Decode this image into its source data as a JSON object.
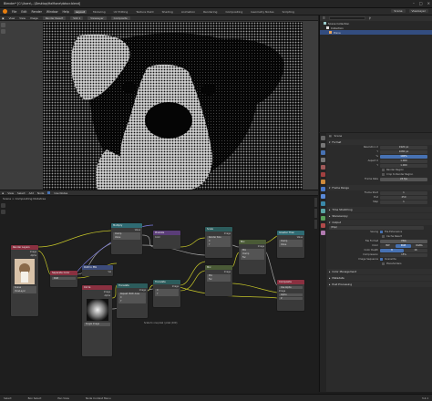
{
  "window": {
    "title": "Blender* [C:\\Users\\...\\Desktop\\Halftone\\dotscr.blend]"
  },
  "menu": {
    "items": [
      "File",
      "Edit",
      "Render",
      "Window",
      "Help"
    ],
    "workspaces": [
      "Layout",
      "Modeling",
      "UV Editing",
      "Texture Paint",
      "Shading",
      "Animation",
      "Rendering",
      "Compositing",
      "Geometry Nodes",
      "Scripting"
    ],
    "active_workspace": "Layout",
    "scene": "Scene",
    "view_layer": "ViewLayer"
  },
  "image_editor": {
    "header": [
      "View",
      "View",
      "Image",
      "Render Result"
    ],
    "slot": "Slot 1",
    "layer": "ViewLayer",
    "pass": "Composite"
  },
  "outliner": {
    "search_placeholder": "",
    "rows": [
      {
        "label": "Scene Collection",
        "selected": false
      },
      {
        "label": "Collection",
        "selected": false
      },
      {
        "label": "Plane",
        "selected": true
      }
    ]
  },
  "properties": {
    "scene_label": "Scene",
    "format_header": "Format",
    "rows": [
      {
        "label": "Resolution X",
        "value": "1920 px",
        "style": "dark"
      },
      {
        "label": "Y",
        "value": "1080 px",
        "style": "dark"
      },
      {
        "label": "%",
        "value": "100%",
        "style": "blue"
      },
      {
        "label": "Aspect X",
        "value": "1.000",
        "style": "dark"
      },
      {
        "label": "Y",
        "value": "1.000",
        "style": "dark"
      }
    ],
    "checks": [
      {
        "label": "Render Region",
        "on": false
      },
      {
        "label": "Crop to Render Region",
        "on": false
      }
    ],
    "frame_rate_label": "Frame Rate",
    "frame_rate": "24 fps",
    "frame_range_header": "Frame Range",
    "frame_rows": [
      {
        "label": "Frame Start",
        "value": "1"
      },
      {
        "label": "End",
        "value": "250"
      },
      {
        "label": "Step",
        "value": "1"
      }
    ],
    "sections": [
      "Time Stretching",
      "Stereoscopy",
      "Output"
    ],
    "output_path": "/tmp/",
    "saving_label": "Saving",
    "file_extensions": "File Extensions",
    "cache_result": "Cache Result",
    "file_format_label": "File Format",
    "file_format": "PNG",
    "color_label": "Color",
    "color_options": [
      "BW",
      "RGB",
      "RGBA"
    ],
    "color_depth_label": "Color Depth",
    "color_depth": [
      "8",
      "16"
    ],
    "compression_label": "Compression",
    "compression": "15%",
    "image_sequence_label": "Image Sequence",
    "overwrite": "Overwrite",
    "placeholders": "Placeholders",
    "color_management": "Color Management",
    "metadata": "Metadata",
    "post_processing": "Post Processing"
  },
  "node_editor": {
    "header": [
      "View",
      "Select",
      "Add",
      "Node"
    ],
    "use_nodes": "Use Nodes",
    "breadcrumb": "Scene  >  Compositing Nodetree",
    "nodes": {
      "render_layers": {
        "title": "Render Layers",
        "out1": "Image",
        "out2": "Alpha",
        "scene": "Scene",
        "layer": "ViewLayer"
      },
      "separate": {
        "title": "Separate Color",
        "rows": [
          "Red",
          "Green",
          "Blue",
          "Alpha"
        ],
        "mode": "RGB"
      },
      "rgb_to_bw": {
        "title": "RGB to BW",
        "rows": [
          "Val"
        ]
      },
      "multiply1": {
        "title": "Multiply",
        "rows": [
          "Value",
          "Clamp",
          "Value"
        ]
      },
      "pixelate": {
        "title": "Pixelate",
        "rows": [
          "Color"
        ]
      },
      "scale": {
        "title": "Scale",
        "rows": [
          "Image",
          "Render Size",
          "X",
          "Y"
        ]
      },
      "image": {
        "title": "Circle",
        "rows": [
          "Image",
          "Alpha",
          "Single Image"
        ]
      },
      "translate": {
        "title": "Translate",
        "rows": [
          "Image",
          "Repeat: Both Axes",
          "X",
          "Y"
        ]
      },
      "translate2": {
        "title": "Translate",
        "rows": [
          "Image",
          "X",
          "Y"
        ]
      },
      "mix1": {
        "title": "Mix",
        "rows": [
          "Image",
          "Mix",
          "Clamp",
          "Fac",
          "Image",
          "Image"
        ]
      },
      "mix2": {
        "title": "Mix",
        "rows": [
          "Image",
          "Mix",
          "Clamp",
          "Fac",
          "Image",
          "Image"
        ]
      },
      "math": {
        "title": "Greater Than",
        "rows": [
          "Value",
          "Clamp",
          "Value",
          "Value"
        ]
      },
      "color_ramp": {
        "title": "Color Ramp",
        "rows": [
          "Image",
          "Alpha"
        ]
      },
      "composite": {
        "title": "Composite",
        "rows": [
          "Use Alpha",
          "Image",
          "Alpha",
          "Z"
        ]
      },
      "viewer": {
        "title": "Viewer",
        "rows": [
          "Image"
        ]
      }
    },
    "frame_label": "Scale to one pixel / pixel (100)"
  },
  "status_bar": {
    "items": [
      "Select",
      "Box Select",
      "Pan View",
      "Node Context Menu"
    ],
    "version": "3.4.1"
  },
  "colors": {
    "accent": "#4772b3",
    "selected_row": "#334d80",
    "blender_orange": "#e87d0d"
  }
}
